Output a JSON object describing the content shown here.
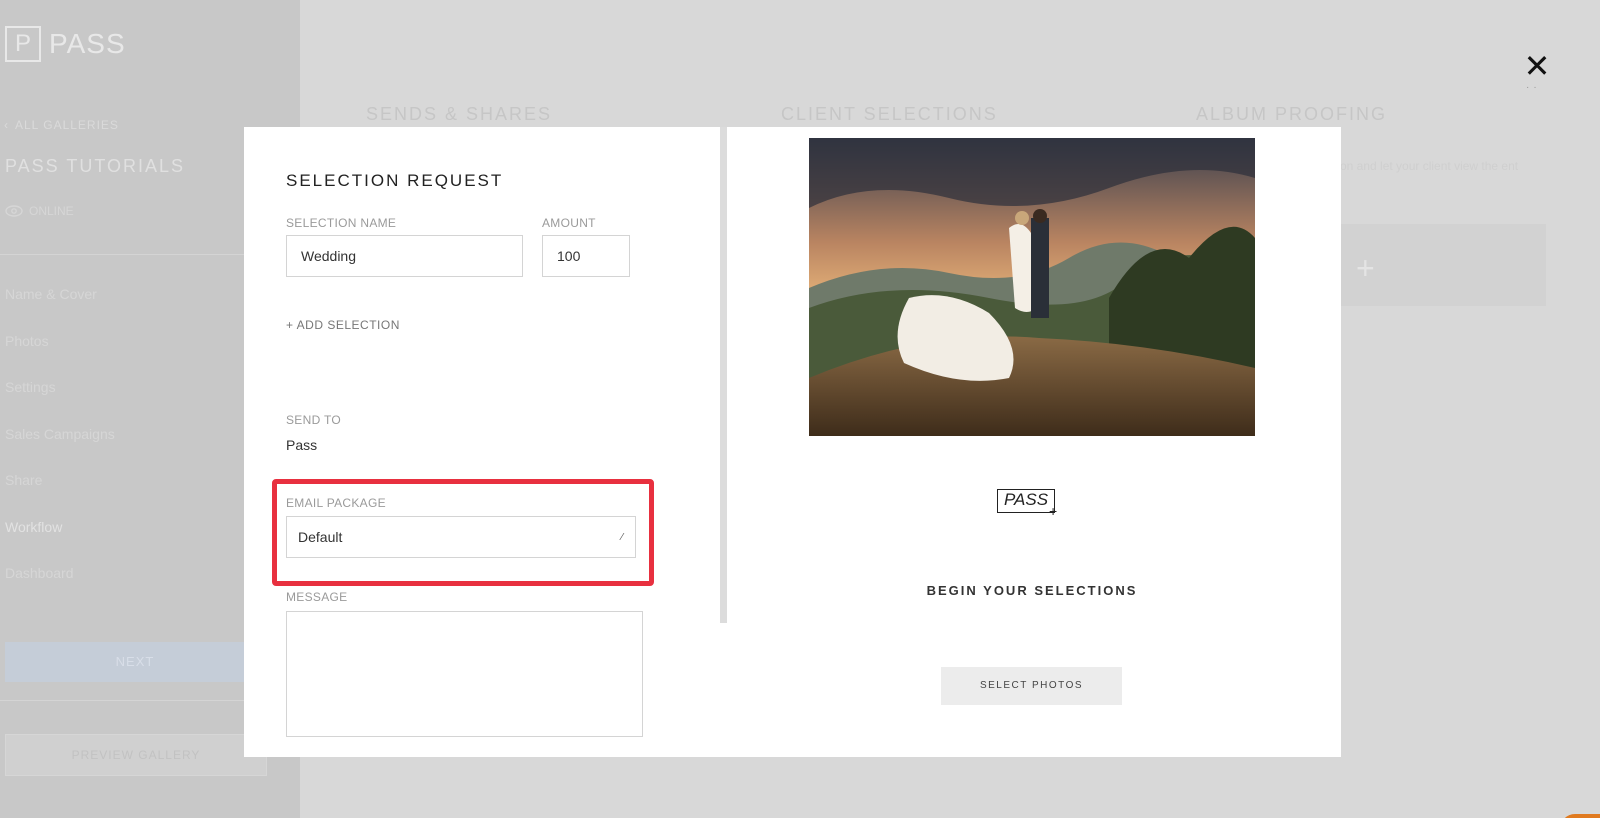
{
  "sidebar": {
    "logo_letter": "P",
    "logo_text": "PASS",
    "back_label": "ALL GALLERIES",
    "gallery_title": "PASS TUTORIALS",
    "status": "ONLINE",
    "nav": [
      "Name & Cover",
      "Photos",
      "Settings",
      "Sales Campaigns",
      "Share",
      "Workflow",
      "Dashboard"
    ],
    "next_label": "NEXT",
    "preview_label": "PREVIEW GALLERY"
  },
  "columns": {
    "sends": "SENDS & SHARES",
    "client": "CLIENT SELECTIONS",
    "album": "ALBUM PROOFING",
    "album_desc": "on and let your client view the ent"
  },
  "modal": {
    "title": "SELECTION REQUEST",
    "selection_name_label": "SELECTION NAME",
    "selection_name_value": "Wedding",
    "amount_label": "AMOUNT",
    "amount_value": "100",
    "add_selection": "+ ADD SELECTION",
    "send_to_label": "SEND TO",
    "send_to_value": "Pass",
    "email_package_label": "EMAIL PACKAGE",
    "email_package_value": "Default",
    "message_label": "MESSAGE",
    "message_value": ""
  },
  "preview": {
    "brand": "PASS",
    "heading": "BEGIN YOUR SELECTIONS",
    "button": "SELECT PHOTOS"
  },
  "colors": {
    "highlight": "#e8303f",
    "overlay": "#d8d8d8"
  }
}
